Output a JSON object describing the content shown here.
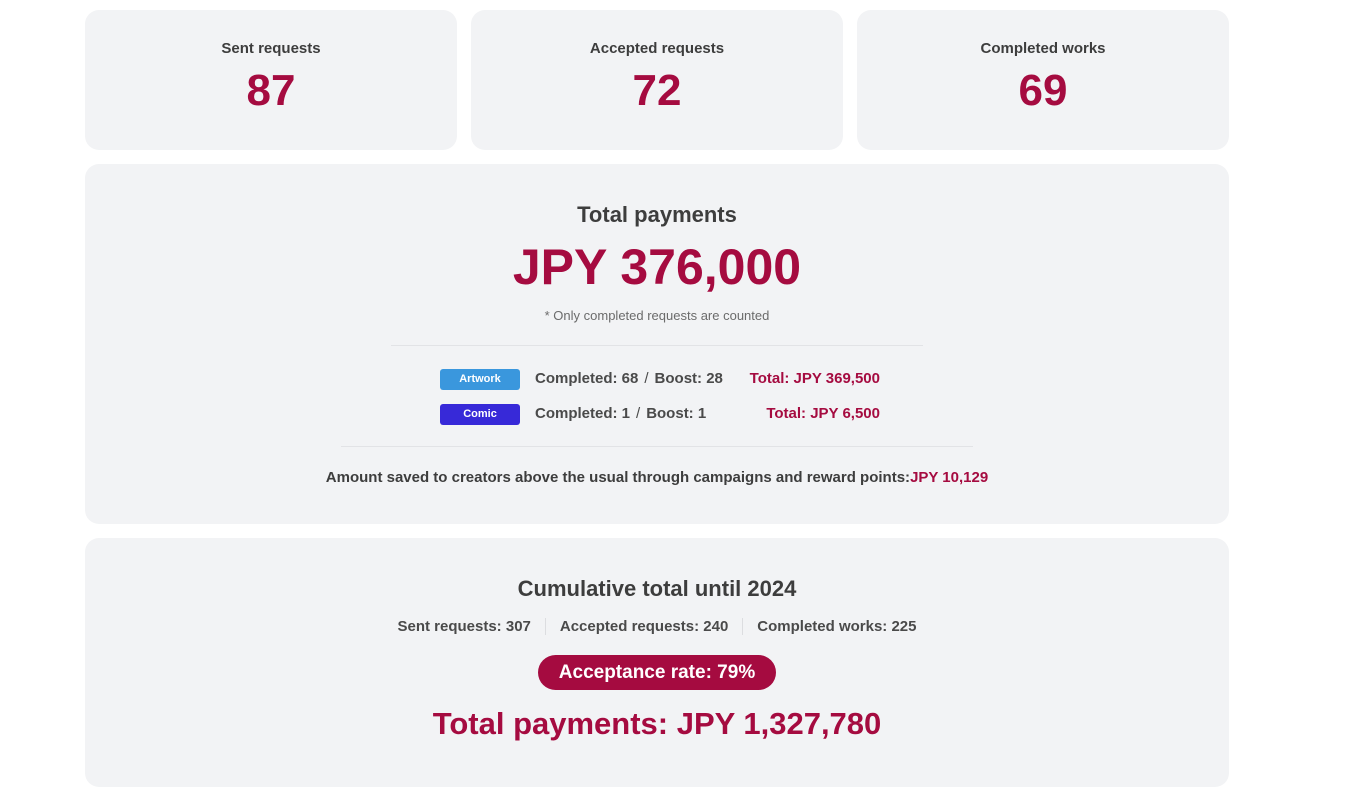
{
  "stats": {
    "sent": {
      "label": "Sent requests",
      "value": "87"
    },
    "accepted": {
      "label": "Accepted requests",
      "value": "72"
    },
    "completed": {
      "label": "Completed works",
      "value": "69"
    }
  },
  "payments": {
    "title": "Total payments",
    "amount": "JPY 376,000",
    "note": "* Only completed requests are counted",
    "breakdown": [
      {
        "badge": "Artwork",
        "completed": "Completed: 68",
        "sep": "/",
        "boost": "Boost: 28",
        "total": "Total: JPY 369,500",
        "badge_color": "#3a97dd"
      },
      {
        "badge": "Comic",
        "completed": "Completed: 1",
        "sep": "/",
        "boost": "Boost: 1",
        "total": "Total: JPY 6,500",
        "badge_color": "#3729d8"
      }
    ],
    "saved_label": "Amount saved to creators above the usual through campaigns and reward points:",
    "saved_amount": "JPY 10,129"
  },
  "cumulative": {
    "title": "Cumulative total until 2024",
    "sent": "Sent requests: 307",
    "accepted": "Accepted requests: 240",
    "completed": "Completed works: 225",
    "acceptance_rate": "Acceptance rate: 79%",
    "total_payments": "Total payments: JPY 1,327,780"
  },
  "colors": {
    "accent": "#a50b40",
    "card_bg": "#f2f3f5",
    "text": "#3d3d3d"
  }
}
